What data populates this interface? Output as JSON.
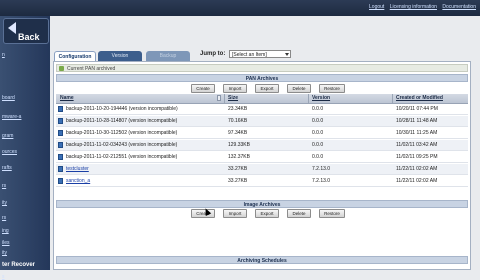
{
  "top_links": [
    "Logout",
    "Licensing information",
    "Documentation"
  ],
  "sidebar": {
    "back_label": "Back",
    "links": [
      "n",
      "board",
      "mware-a",
      "gram",
      "ources",
      "rafts",
      "rs",
      "ity",
      "rs",
      "ing",
      "iles",
      "ity",
      "s"
    ],
    "section_header": "ter Recover"
  },
  "tabs": [
    "Configuration",
    "Version",
    "Backup"
  ],
  "jump": {
    "label": "Jump to:",
    "selected": "[Select an Item]"
  },
  "status": {
    "text": "Current PAN archived"
  },
  "pan_archives": {
    "title": "PAN Archives",
    "buttons": [
      "Create",
      "Import",
      "Export",
      "Delete",
      "Restore"
    ],
    "columns": [
      "Name",
      "Size",
      "Version",
      "Created or Modified"
    ],
    "rows": [
      {
        "name": "backup-2011-10-20-194446 (version incompatible)",
        "size": "23.34KB",
        "version": "0.0.0",
        "created": "10/20/11 07:44 PM",
        "link": false
      },
      {
        "name": "backup-2011-10-28-114807 (version incompatible)",
        "size": "70.16KB",
        "version": "0.0.0",
        "created": "10/28/11 11:48 AM",
        "link": false
      },
      {
        "name": "backup-2011-10-30-112502 (version incompatible)",
        "size": "97.34KB",
        "version": "0.0.0",
        "created": "10/30/11 11:25 AM",
        "link": false
      },
      {
        "name": "backup-2011-11-02-034243 (version incompatible)",
        "size": "129.33KB",
        "version": "0.0.0",
        "created": "11/02/11 03:42 AM",
        "link": false
      },
      {
        "name": "backup-2011-11-02-212551 (version incompatible)",
        "size": "132.37KB",
        "version": "0.0.0",
        "created": "11/02/11 09:25 PM",
        "link": false
      },
      {
        "name": "testcluster",
        "size": "33.27KB",
        "version": "7.2.13.0",
        "created": "11/22/11 02:02 AM",
        "link": true
      },
      {
        "name": "sanction_a",
        "size": "33.27KB",
        "version": "7.2.13.0",
        "created": "11/22/11 02:02 AM",
        "link": true
      }
    ]
  },
  "image_archives": {
    "title": "Image Archives",
    "buttons": [
      "Create",
      "Import",
      "Export",
      "Delete",
      "Restore"
    ]
  },
  "archiving_schedules": {
    "title": "Archiving Schedules"
  },
  "colors": {
    "accent": "#1d2a40",
    "tab_active": "#ffffff",
    "section_header": "#c8d3e3"
  }
}
